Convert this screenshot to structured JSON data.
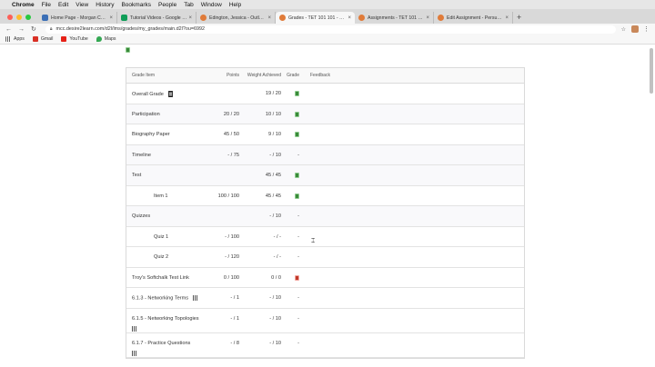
{
  "menubar": {
    "app": "Chrome",
    "items": [
      "File",
      "Edit",
      "View",
      "History",
      "Bookmarks",
      "People",
      "Tab",
      "Window",
      "Help"
    ]
  },
  "tabs": [
    {
      "title": "Home Page - Morgan Communi...",
      "color": "#3b6fb6"
    },
    {
      "title": "Tutorial Videos - Google Sheets",
      "color": "#0f9d58"
    },
    {
      "title": "Edington, Jessica - Outlook Web",
      "color": "#e07b39"
    },
    {
      "title": "Grades - TET 101 101 - Sample",
      "color": "#e07b39"
    },
    {
      "title": "Assignments - TET 101 101 - Sa",
      "color": "#e07b39"
    },
    {
      "title": "Edit Assignment - Persuasive Re",
      "color": "#e07b39"
    }
  ],
  "url": "mcc.desire2learn.com/d2l/lms/grades/my_grades/main.d2l?ou=6992",
  "bookmarks": [
    {
      "label": "Apps",
      "color": "#666"
    },
    {
      "label": "Gmail",
      "color": "#d93025"
    },
    {
      "label": "YouTube",
      "color": "#e62117"
    },
    {
      "label": "Maps",
      "color": "#34a853"
    }
  ],
  "table": {
    "headers": {
      "item": "Grade Item",
      "points": "Points",
      "weight": "Weight Achieved",
      "grade": "Grade",
      "feedback": "Feedback"
    },
    "rows": [
      {
        "item": "Overall Grade",
        "points": "",
        "weight": "19 / 20",
        "grade": "good"
      },
      {
        "item": "Participation",
        "points": "20 / 20",
        "weight": "10 / 10",
        "grade": "good"
      },
      {
        "item": "Biography Paper",
        "points": "45 / 50",
        "weight": "9 / 10",
        "grade": "good"
      },
      {
        "item": "Timeline",
        "points": "- / 75",
        "weight": "- / 10",
        "grade": "-"
      },
      {
        "item": "Test",
        "points": "",
        "weight": "45 / 45",
        "grade": "good"
      },
      {
        "item": "Item 1",
        "points": "100 / 100",
        "weight": "45 / 45",
        "grade": "good"
      },
      {
        "item": "Quizzes",
        "points": "",
        "weight": "- / 10",
        "grade": "-"
      },
      {
        "item": "Quiz 1",
        "points": "- / 100",
        "weight": "- / -",
        "grade": "-"
      },
      {
        "item": "Quiz 2",
        "points": "- / 120",
        "weight": "- / -",
        "grade": "-"
      },
      {
        "item": "Troy's Softchalk Test Link",
        "points": "0 / 100",
        "weight": "0 / 0",
        "grade": "bad"
      },
      {
        "item": "6.1.3 - Networking Terms",
        "points": "- / 1",
        "weight": "- / 10",
        "grade": "-"
      },
      {
        "item": "6.1.5 - Networking Topologies",
        "points": "- / 1",
        "weight": "- / 10",
        "grade": "-"
      },
      {
        "item": "6.1.7 - Practice Questions",
        "points": "- / 8",
        "weight": "- / 10",
        "grade": "-"
      }
    ]
  }
}
